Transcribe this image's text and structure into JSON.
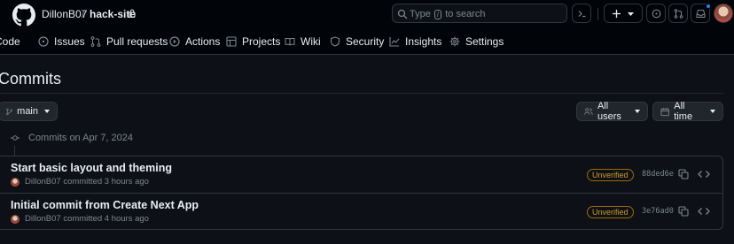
{
  "header": {
    "owner": "DillonB07",
    "separator": "/",
    "repo": "hack-site",
    "search_prefix": "Type",
    "search_key": "/",
    "search_suffix": "to search"
  },
  "nav": {
    "items": [
      {
        "label": "Code",
        "icon": "code-icon"
      },
      {
        "label": "Issues",
        "icon": "issue-icon"
      },
      {
        "label": "Pull requests",
        "icon": "pull-request-icon"
      },
      {
        "label": "Actions",
        "icon": "play-icon"
      },
      {
        "label": "Projects",
        "icon": "table-icon"
      },
      {
        "label": "Wiki",
        "icon": "book-icon"
      },
      {
        "label": "Security",
        "icon": "shield-icon"
      },
      {
        "label": "Insights",
        "icon": "graph-icon"
      },
      {
        "label": "Settings",
        "icon": "gear-icon"
      }
    ]
  },
  "page": {
    "title": "Commits",
    "branch": "main",
    "users_filter": "All users",
    "time_filter": "All time",
    "date_group": "Commits on Apr 7, 2024"
  },
  "commits": [
    {
      "message": "Start basic layout and theming",
      "author": "DillonB07",
      "action": "committed",
      "time": "3 hours ago",
      "status": "Unverified",
      "sha": "88ded6e"
    },
    {
      "message": "Initial commit from Create Next App",
      "author": "DillonB07",
      "action": "committed",
      "time": "4 hours ago",
      "status": "Unverified",
      "sha": "3e76ad0"
    }
  ],
  "colors": {
    "background": "#0d1117",
    "header_bg": "#010409",
    "border": "#30363d",
    "text": "#e6edf3",
    "muted": "#7d8590",
    "warning": "#d29922",
    "accent": "#2f81f7"
  }
}
